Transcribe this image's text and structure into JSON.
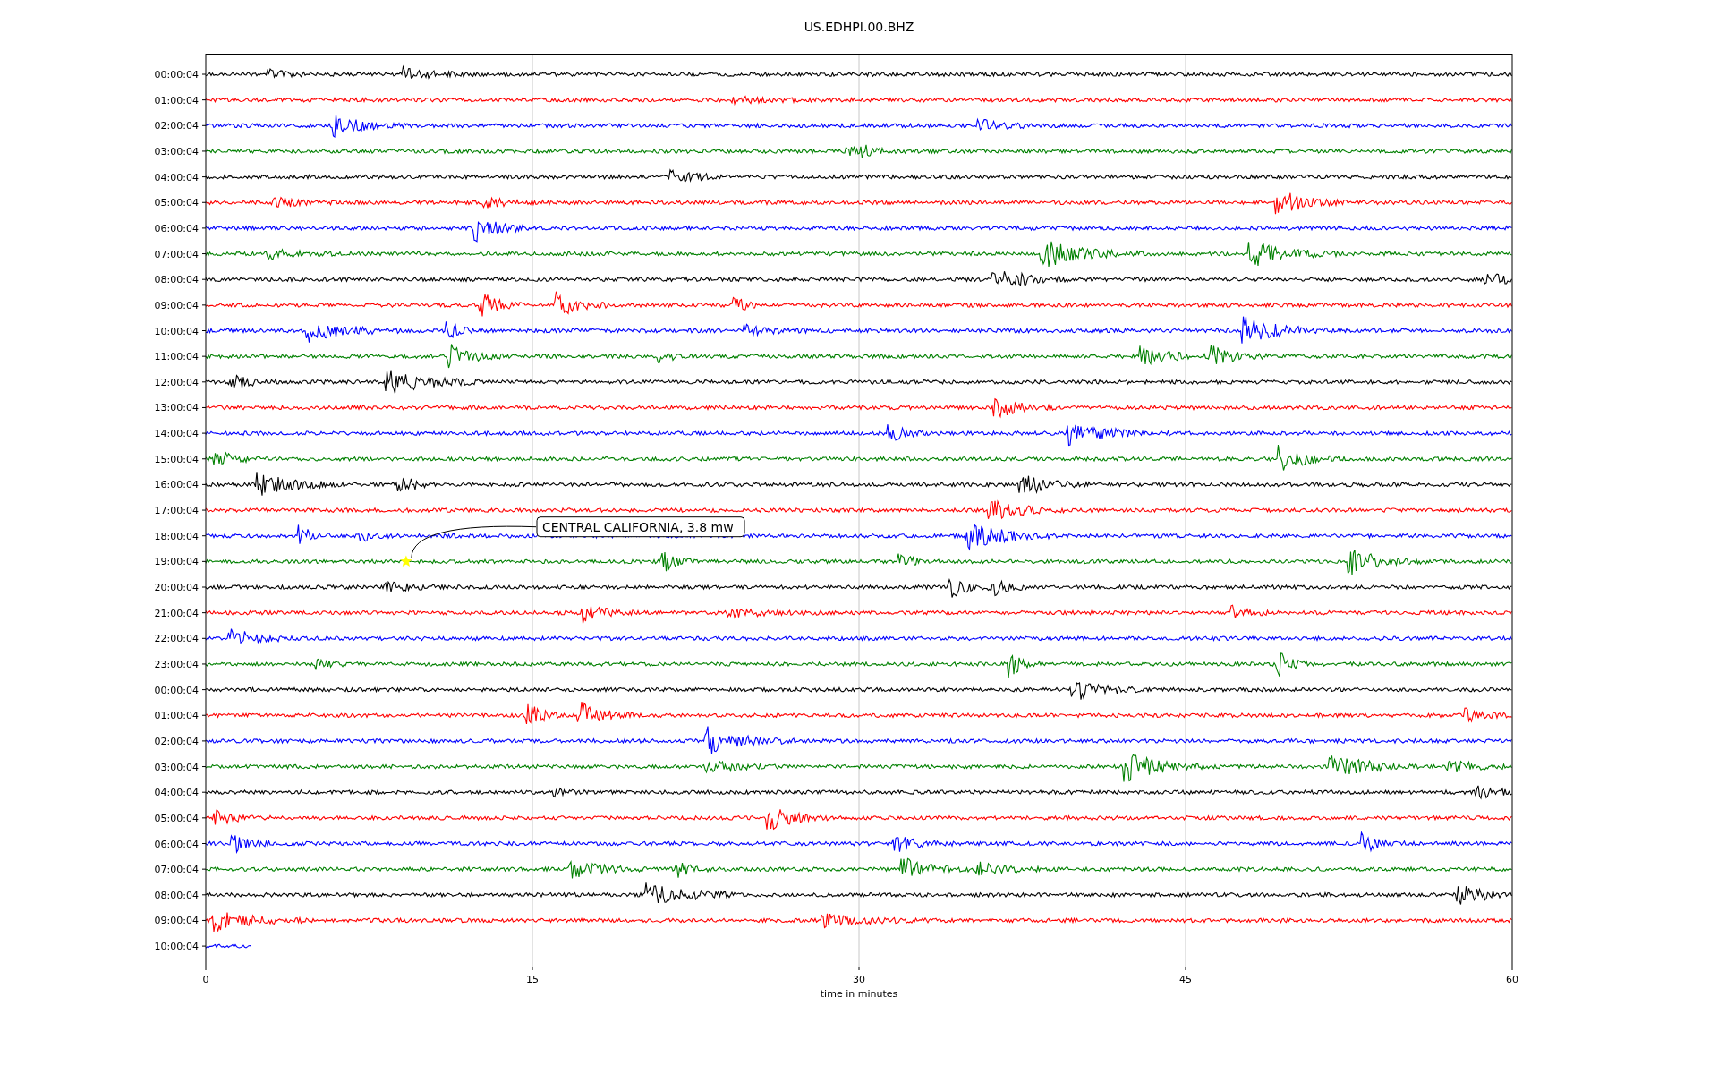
{
  "title": "US.EDHPI.00.BHZ",
  "traces": [
    {
      "label": "00:00:04",
      "color": "#000000",
      "partial": false
    },
    {
      "label": "01:00:04",
      "color": "#ff0000",
      "partial": false
    },
    {
      "label": "02:00:04",
      "color": "#0000ff",
      "partial": false
    },
    {
      "label": "03:00:04",
      "color": "#008000",
      "partial": false
    },
    {
      "label": "04:00:04",
      "color": "#000000",
      "partial": false
    },
    {
      "label": "05:00:04",
      "color": "#ff0000",
      "partial": false
    },
    {
      "label": "06:00:04",
      "color": "#0000ff",
      "partial": false
    },
    {
      "label": "07:00:04",
      "color": "#008000",
      "partial": false
    },
    {
      "label": "08:00:04",
      "color": "#000000",
      "partial": false
    },
    {
      "label": "09:00:04",
      "color": "#ff0000",
      "partial": false
    },
    {
      "label": "10:00:04",
      "color": "#0000ff",
      "partial": false
    },
    {
      "label": "11:00:04",
      "color": "#008000",
      "partial": false
    },
    {
      "label": "12:00:04",
      "color": "#000000",
      "partial": false
    },
    {
      "label": "13:00:04",
      "color": "#ff0000",
      "partial": false
    },
    {
      "label": "14:00:04",
      "color": "#0000ff",
      "partial": false
    },
    {
      "label": "15:00:04",
      "color": "#008000",
      "partial": false
    },
    {
      "label": "16:00:04",
      "color": "#000000",
      "partial": false
    },
    {
      "label": "17:00:04",
      "color": "#ff0000",
      "partial": false
    },
    {
      "label": "18:00:04",
      "color": "#0000ff",
      "partial": false
    },
    {
      "label": "19:00:04",
      "color": "#008000",
      "partial": false
    },
    {
      "label": "20:00:04",
      "color": "#000000",
      "partial": false
    },
    {
      "label": "21:00:04",
      "color": "#ff0000",
      "partial": false
    },
    {
      "label": "22:00:04",
      "color": "#0000ff",
      "partial": false
    },
    {
      "label": "23:00:04",
      "color": "#008000",
      "partial": false
    },
    {
      "label": "00:00:04",
      "color": "#000000",
      "partial": false
    },
    {
      "label": "01:00:04",
      "color": "#ff0000",
      "partial": false
    },
    {
      "label": "02:00:04",
      "color": "#0000ff",
      "partial": false
    },
    {
      "label": "03:00:04",
      "color": "#008000",
      "partial": false
    },
    {
      "label": "04:00:04",
      "color": "#000000",
      "partial": false
    },
    {
      "label": "05:00:04",
      "color": "#ff0000",
      "partial": false
    },
    {
      "label": "06:00:04",
      "color": "#0000ff",
      "partial": false
    },
    {
      "label": "07:00:04",
      "color": "#008000",
      "partial": false
    },
    {
      "label": "08:00:04",
      "color": "#000000",
      "partial": false
    },
    {
      "label": "09:00:04",
      "color": "#ff0000",
      "partial": false
    },
    {
      "label": "10:00:04",
      "color": "#0000ff",
      "partial": true
    }
  ],
  "x_ticks": [
    "0",
    "15",
    "30",
    "45",
    "60"
  ],
  "x_label": "time in minutes",
  "annotation": "CENTRAL CALIFORNIA, 3.8 mw"
}
